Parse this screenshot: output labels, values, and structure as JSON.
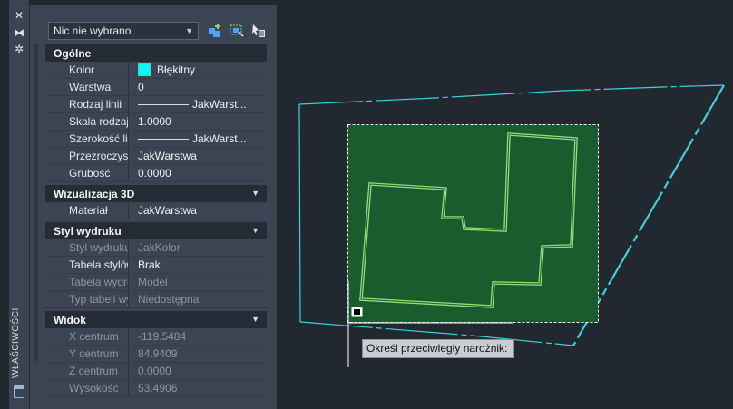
{
  "palette": {
    "title": "WŁAŚCIWOŚCI",
    "close_icon": "close-icon",
    "autohide_icon": "autohide-icon",
    "properties_icon": "properties-icon"
  },
  "toolbar": {
    "selection": "Nic nie wybrano",
    "quick_select_icon": "quick-select-icon",
    "select_objects_icon": "select-objects-icon",
    "toggle_pickadd_icon": "toggle-pickadd-icon"
  },
  "sections": {
    "general": {
      "title": "Ogólne",
      "rows": [
        {
          "name": "Kolor",
          "value": "Błękitny"
        },
        {
          "name": "Warstwa",
          "value": "0"
        },
        {
          "name": "Rodzaj linii",
          "value": "JakWarst..."
        },
        {
          "name": "Skala rodzaju li...",
          "value": "1.0000"
        },
        {
          "name": "Szerokość linii",
          "value": "JakWarst..."
        },
        {
          "name": "Przezroczystość",
          "value": "JakWarstwa"
        },
        {
          "name": "Grubość",
          "value": "0.0000"
        }
      ]
    },
    "viz3d": {
      "title": "Wizualizacja 3D",
      "rows": [
        {
          "name": "Materiał",
          "value": "JakWarstwa"
        }
      ]
    },
    "plot": {
      "title": "Styl wydruku",
      "rows": [
        {
          "name": "Styl wydruku",
          "value": "JakKolor"
        },
        {
          "name": "Tabela stylów...",
          "value": "Brak"
        },
        {
          "name": "Tabela wydruk...",
          "value": "Model"
        },
        {
          "name": "Typ tabeli wyd...",
          "value": "Niedostępna"
        }
      ]
    },
    "view": {
      "title": "Widok",
      "rows": [
        {
          "name": "X centrum",
          "value": "-119.5484"
        },
        {
          "name": "Y centrum",
          "value": "84.9409"
        },
        {
          "name": "Z centrum",
          "value": "0.0000"
        },
        {
          "name": "Wysokość",
          "value": "53.4906"
        }
      ]
    }
  },
  "drawing": {
    "prompt": "Określ przeciwległy narożnik:",
    "window_fill": "#1a5c2e",
    "outline_color": "#8ee07a",
    "cyan_line": "#3fd0d8"
  }
}
